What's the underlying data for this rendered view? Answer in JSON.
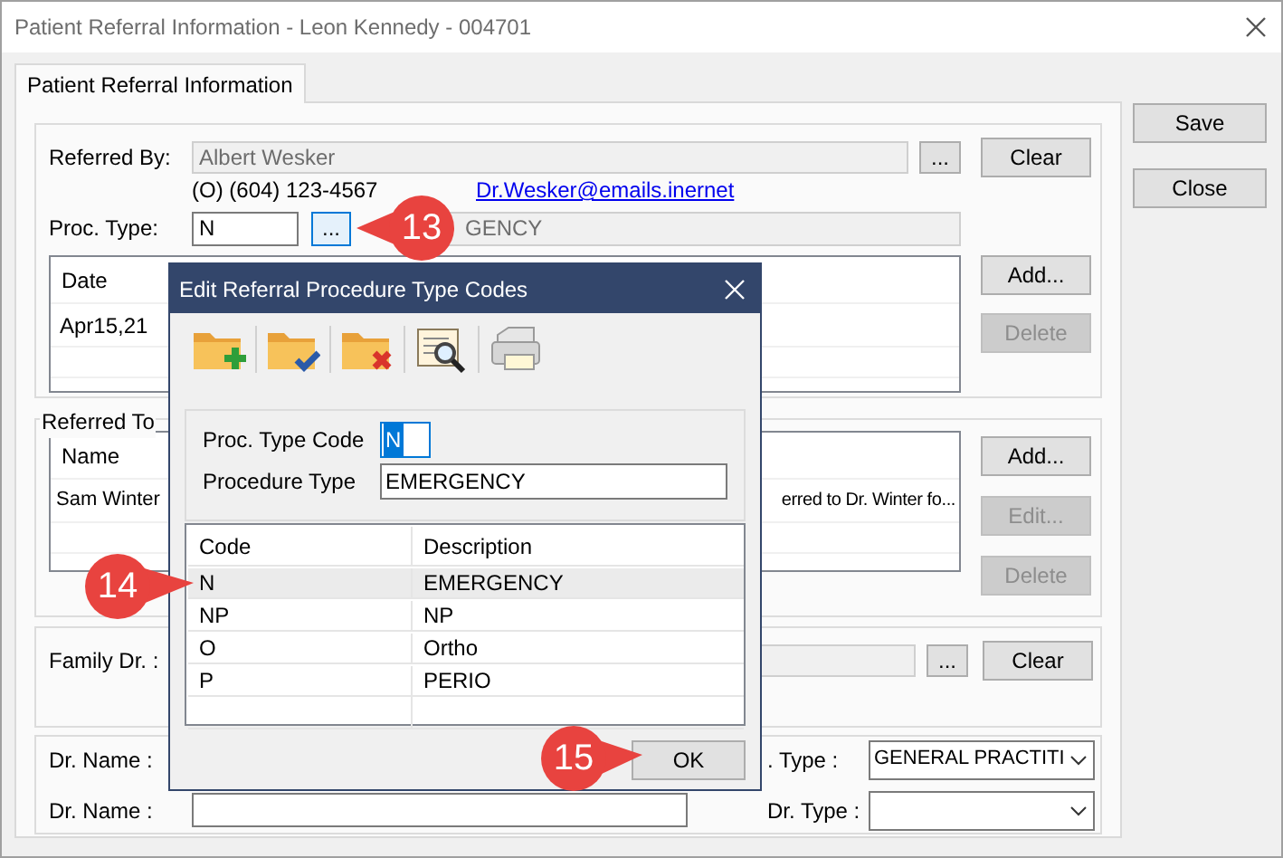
{
  "window": {
    "title": "Patient Referral Information - Leon Kennedy - 004701"
  },
  "tabs": [
    {
      "label": "Patient Referral Information",
      "selected": true
    }
  ],
  "side_buttons": [
    "Save",
    "Close"
  ],
  "referred_by": {
    "label": "Referred By:",
    "value": "Albert Wesker",
    "browse": "...",
    "clear": "Clear",
    "phone": "(O) (604) 123-4567",
    "email": "Dr.Wesker@emails.inernet"
  },
  "proc_type": {
    "label": "Proc. Type:",
    "code": "N",
    "browse": "...",
    "description": "GENCY"
  },
  "referral_list": {
    "columns": [
      "Date"
    ],
    "rows": [
      [
        "Apr15,21"
      ]
    ],
    "buttons": [
      {
        "label": "Add...",
        "disabled": false
      },
      {
        "label": "Delete",
        "disabled": true
      }
    ]
  },
  "referred_to": {
    "legend": "Referred To",
    "columns": [
      "Name"
    ],
    "rows": [
      {
        "name": "Sam Winter",
        "note": "erred to Dr. Winter fo..."
      }
    ],
    "buttons": [
      {
        "label": "Add...",
        "disabled": false
      },
      {
        "label": "Edit...",
        "disabled": true
      },
      {
        "label": "Delete",
        "disabled": true
      }
    ]
  },
  "family_dr": {
    "label": "Family Dr. :",
    "browse": "...",
    "clear": "Clear"
  },
  "doctors": [
    {
      "name_label": "Dr. Name :",
      "name_field": false,
      "type_label": ". Type :",
      "type_value": "GENERAL PRACTITI"
    },
    {
      "name_label": "Dr. Name :",
      "name_field": true,
      "type_label": "Dr. Type :"
    }
  ],
  "dialog": {
    "title": "Edit Referral Procedure Type Codes",
    "toolbar": [
      {
        "kind": "add"
      },
      {
        "kind": "edit"
      },
      {
        "kind": "delete"
      },
      {
        "kind": "preview"
      },
      {
        "kind": "print"
      }
    ],
    "code_label": "Proc. Type Code",
    "code_value": "N",
    "type_label": "Procedure Type",
    "type_value": "EMERGENCY",
    "grid": {
      "columns": [
        "Code",
        "Description"
      ],
      "rows": [
        {
          "cells": [
            "N",
            "EMERGENCY"
          ],
          "selected": true
        },
        {
          "cells": [
            "NP",
            "NP"
          ],
          "selected": false
        },
        {
          "cells": [
            "O",
            "Ortho"
          ],
          "selected": false
        },
        {
          "cells": [
            "P",
            "PERIO"
          ],
          "selected": false
        }
      ]
    },
    "ok": "OK"
  },
  "callouts": [
    {
      "label": "13"
    },
    {
      "label": "14"
    },
    {
      "label": "15"
    }
  ]
}
